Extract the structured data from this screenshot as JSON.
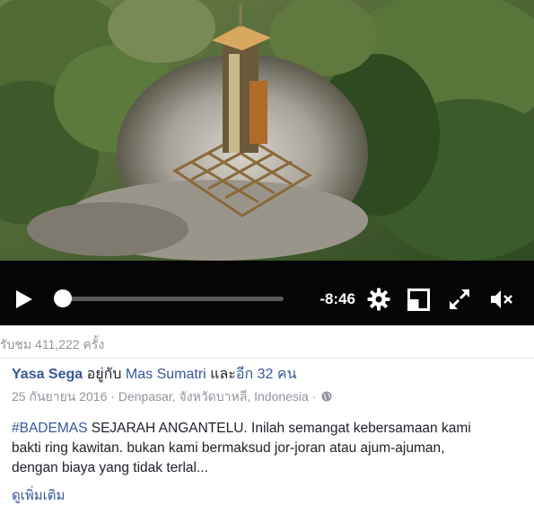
{
  "video": {
    "description_icon": "aerial-video-frame",
    "controls": {
      "play_icon": "play-icon",
      "progress": 0.01,
      "time_remaining": "-8:46",
      "settings_icon": "gear-icon",
      "popout_icon": "popout-icon",
      "fullscreen_icon": "expand-icon",
      "mute_icon": "mute-icon"
    }
  },
  "post": {
    "views": "รับชม 411,222 ครั้ง",
    "author": "Yasa Sega",
    "with_text": "อยู่กับ",
    "tagged": "Mas Sumatri",
    "and_text": "และ",
    "others": "อีก 32 คน",
    "date": "25 กันยายน 2016",
    "separator": "·",
    "location": "Denpasar, จังหวัดบาหลี, Indonesia",
    "privacy_icon": "globe-icon",
    "hashtag": "#BADEMAS",
    "text_line1_rest": " SEJARAH ANGANTELU. Inilah semangat kebersamaan kami",
    "text_line2": "bakti ring kawitan. bukan kami bermaksud jor-joran atau ajum-ajuman,",
    "text_line3": "dengan biaya yang tidak terlal...",
    "see_more": "ดูเพิ่มเติม"
  },
  "colors": {
    "link": "#365899",
    "meta": "#90949c",
    "text": "#1d2129",
    "control_bar": "#050505"
  }
}
